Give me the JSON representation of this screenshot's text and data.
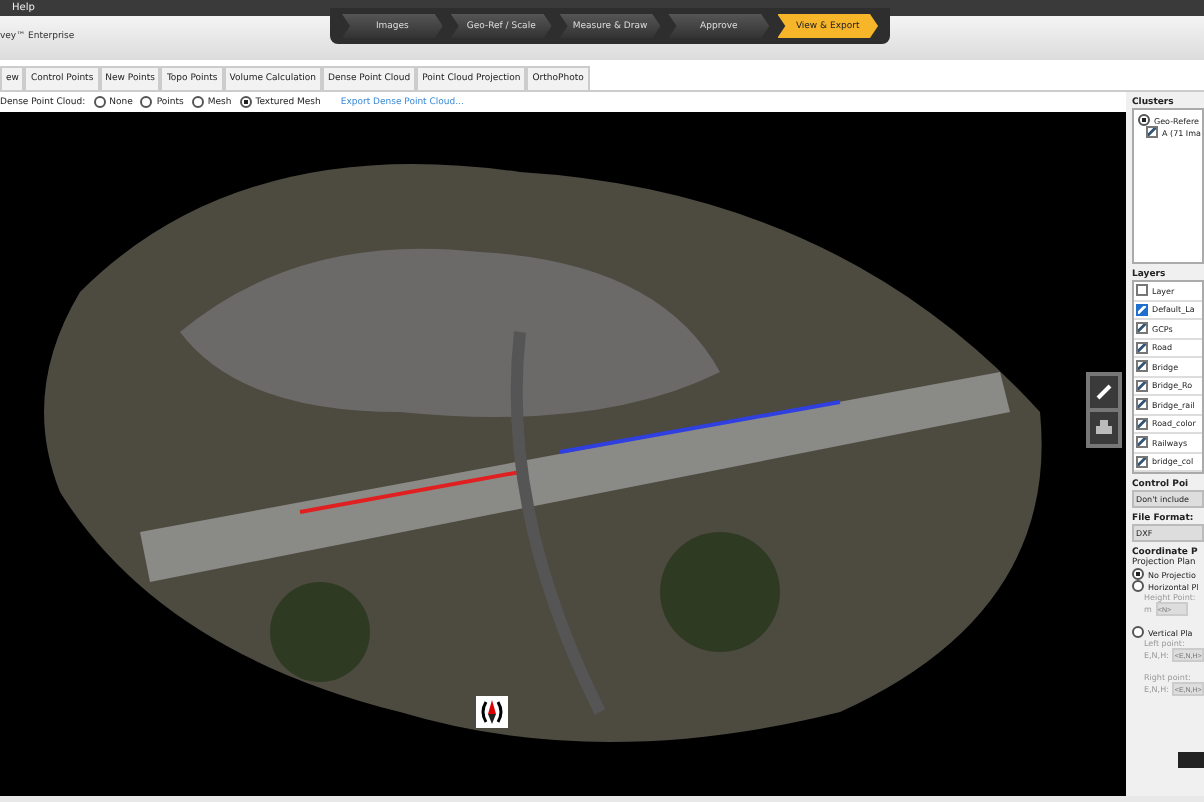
{
  "menu": {
    "label": "Help"
  },
  "app_title": "vey™ Enterprise",
  "steps": [
    {
      "label": "Images",
      "selected": false
    },
    {
      "label": "Geo-Ref / Scale",
      "selected": false
    },
    {
      "label": "Measure & Draw",
      "selected": false
    },
    {
      "label": "Approve",
      "selected": false
    },
    {
      "label": "View & Export",
      "selected": true
    }
  ],
  "tabs": [
    "ew",
    "Control Points",
    "New Points",
    "Topo Points",
    "Volume Calculation",
    "Dense Point Cloud",
    "Point Cloud Projection",
    "OrthoPhoto"
  ],
  "display": {
    "label": "Dense Point Cloud:",
    "options": [
      {
        "label": "None",
        "selected": false
      },
      {
        "label": "Points",
        "selected": false
      },
      {
        "label": "Mesh",
        "selected": false
      },
      {
        "label": "Textured Mesh",
        "selected": true
      }
    ],
    "link": "Export Dense Point Cloud..."
  },
  "clusters": {
    "title": "Clusters",
    "root": {
      "label": "Geo-Refere",
      "selected": true
    },
    "children": [
      {
        "label": "A (71 Ima",
        "checked": true
      }
    ]
  },
  "layers": {
    "title": "Layers",
    "header": {
      "label": "Layer",
      "checked": false
    },
    "rows": [
      {
        "label": "Default_La",
        "checked": true,
        "selected": true
      },
      {
        "label": "GCPs",
        "checked": true,
        "selected": false
      },
      {
        "label": "Road",
        "checked": true,
        "selected": false
      },
      {
        "label": "Bridge",
        "checked": true,
        "selected": false
      },
      {
        "label": "Bridge_Ro",
        "checked": true,
        "selected": false
      },
      {
        "label": "Bridge_rail",
        "checked": true,
        "selected": false
      },
      {
        "label": "Road_color",
        "checked": true,
        "selected": false
      },
      {
        "label": "Railways",
        "checked": true,
        "selected": false
      },
      {
        "label": "bridge_col",
        "checked": true,
        "selected": false
      }
    ]
  },
  "control_points": {
    "label": "Control Poi",
    "value": "Don't include"
  },
  "file_format": {
    "label": "File Format:",
    "value": "DXF"
  },
  "coordinate": {
    "title": "Coordinate P",
    "subtitle": "Projection Plan",
    "options": [
      {
        "label": "No Projectio",
        "selected": true
      },
      {
        "label": "Horizontal Pl",
        "selected": false
      }
    ],
    "height": {
      "label": "Height Point:",
      "unit": "m",
      "placeholder": "<N>"
    },
    "vertical": {
      "label": "Vertical Pla",
      "selected": false
    },
    "left": {
      "label": "Left point:",
      "coord": "E,N,H:",
      "placeholder": "<E,N,H>"
    },
    "right": {
      "label": "Right point:",
      "coord": "E,N,H:",
      "placeholder": "<E,N,H>"
    }
  }
}
